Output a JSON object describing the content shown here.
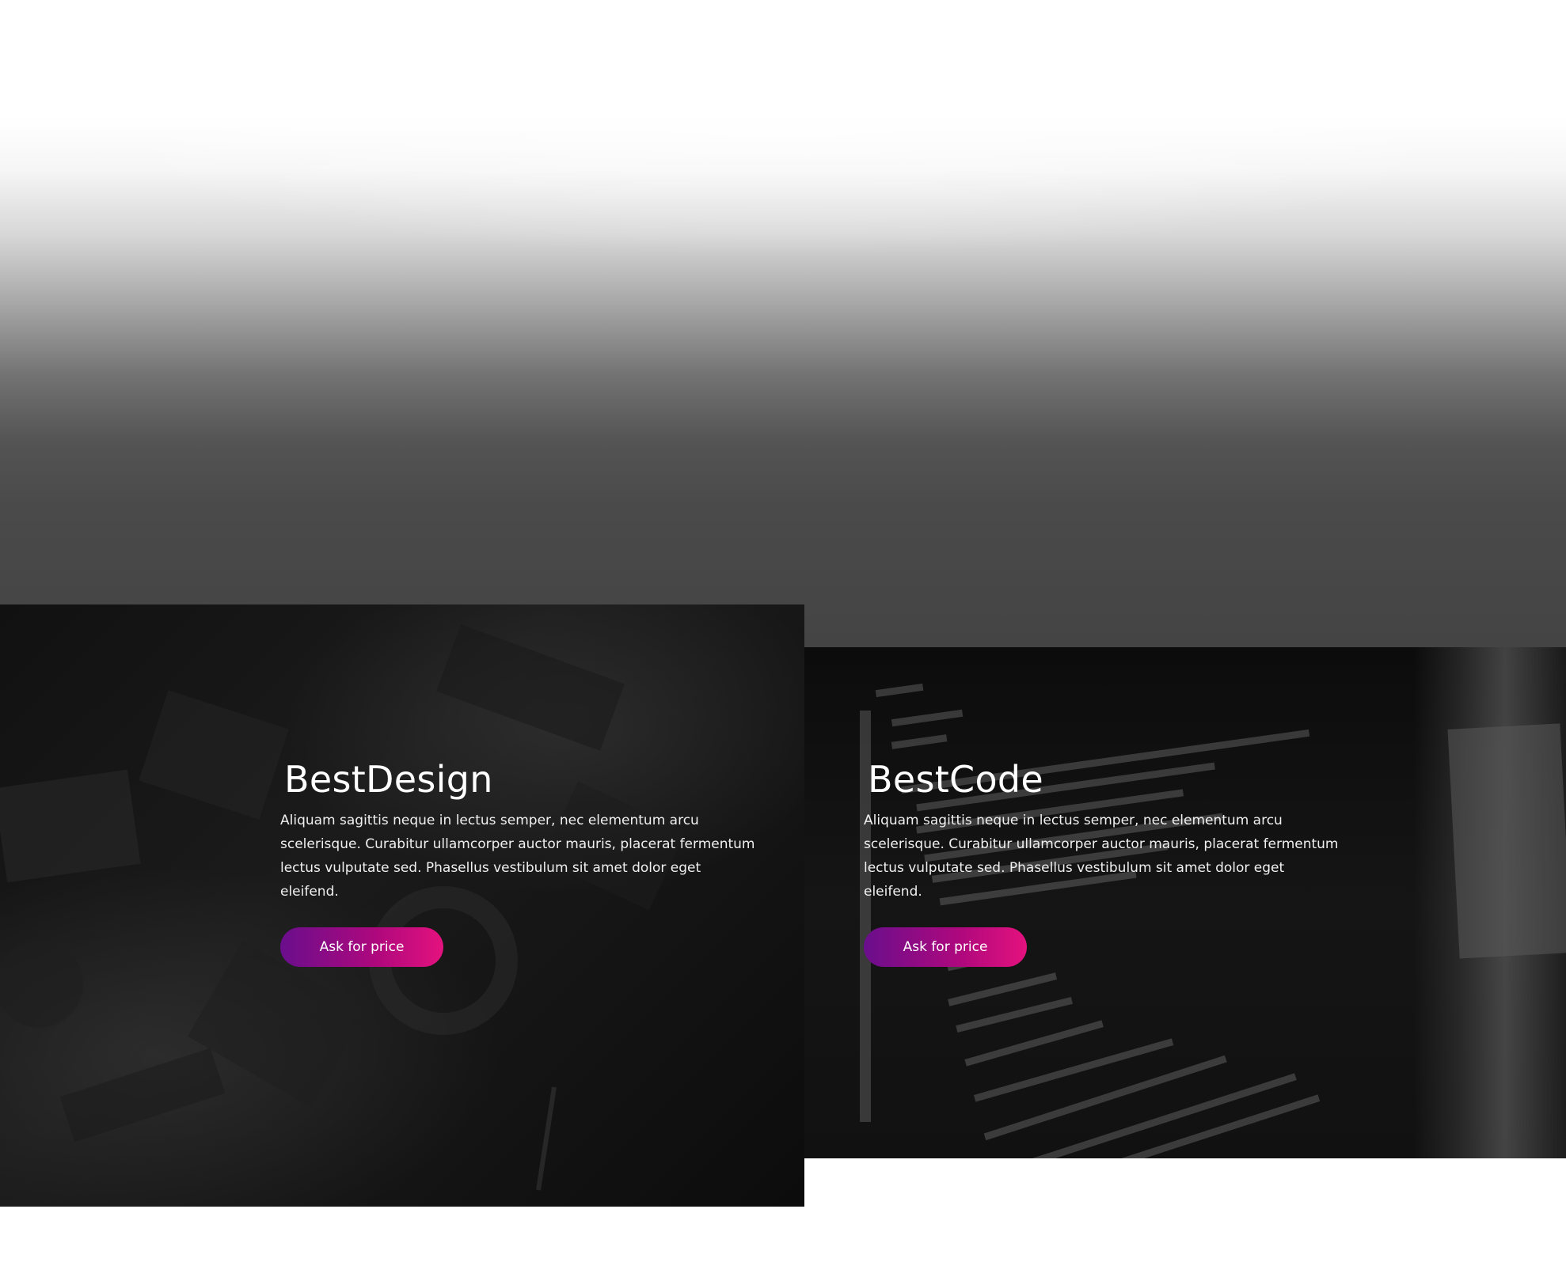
{
  "cards": [
    {
      "title": "BestDesign",
      "description": "Aliquam sagittis neque in lectus semper, nec elementum arcu scelerisque. Curabitur ullamcorper auctor mauris, placerat fermentum lectus vulputate sed. Phasellus vestibulum sit amet dolor eget eleifend.",
      "button_label": "Ask for price"
    },
    {
      "title": "BestCode",
      "description": "Aliquam sagittis neque in lectus semper, nec elementum arcu scelerisque. Curabitur ullamcorper auctor mauris, placerat fermentum lectus vulputate sed. Phasellus vestibulum sit amet dolor eget eleifend.",
      "button_label": "Ask for price"
    }
  ],
  "colors": {
    "button_gradient_start": "#6a0e8c",
    "button_gradient_end": "#e4127e",
    "card_background": "#0d0d0d",
    "text": "#ffffff"
  }
}
